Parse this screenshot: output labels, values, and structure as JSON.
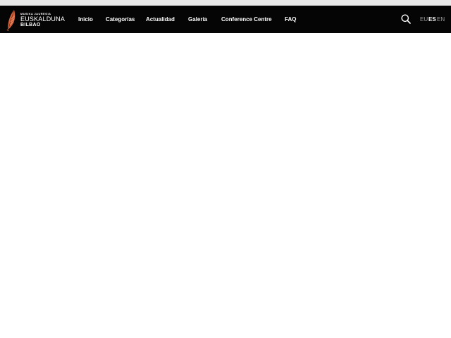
{
  "logo": {
    "small_text": "MUSIKA JAUREGIA",
    "main_text": "EUSKALDUNA",
    "city_text": "BILBAO",
    "icon": "feather-logo-icon",
    "accent": "#d2643c"
  },
  "nav": {
    "items": [
      {
        "label": "Inicio"
      },
      {
        "label": "Categorías"
      },
      {
        "label": "Actualidad"
      },
      {
        "label": "Galería"
      },
      {
        "label": "Conference Centre"
      },
      {
        "label": "FAQ"
      }
    ]
  },
  "search": {
    "icon": "search-icon"
  },
  "languages": [
    {
      "code": "EU",
      "active": false
    },
    {
      "code": "ES",
      "active": true
    },
    {
      "code": "EN",
      "active": false
    }
  ],
  "colors": {
    "navbar_bg": "#050505",
    "nav_text": "#ffffff",
    "lang_inactive": "#9a9a9a"
  }
}
